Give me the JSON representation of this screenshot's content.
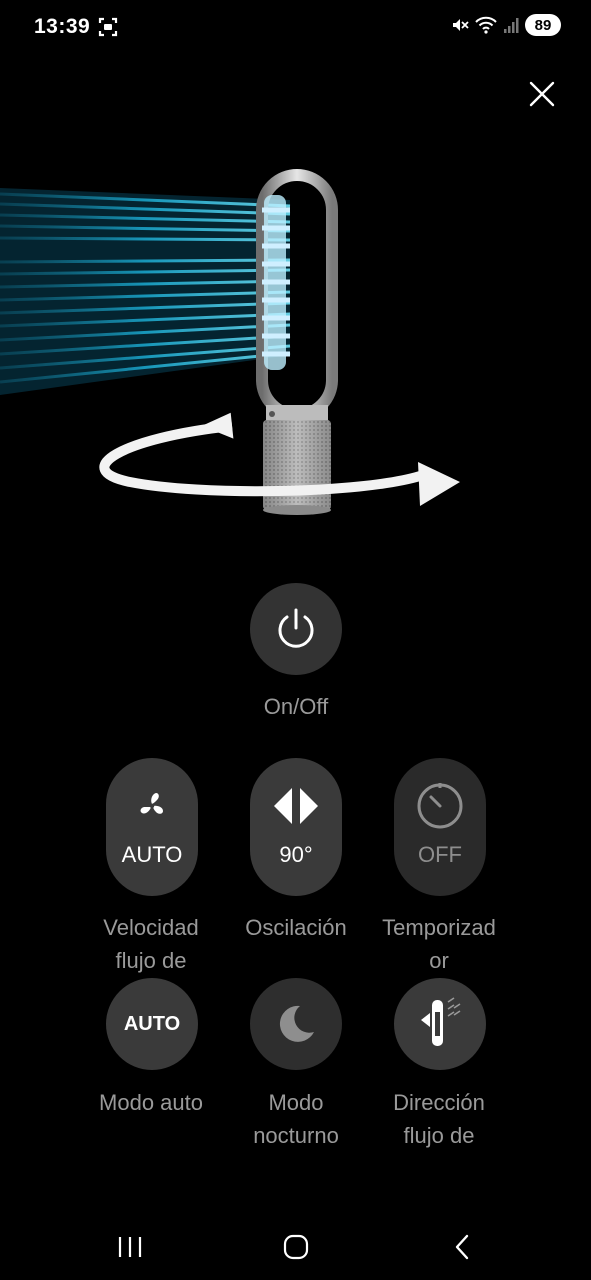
{
  "status_bar": {
    "time": "13:39",
    "battery": "89",
    "icons": [
      "screenshot-icon",
      "mute-icon",
      "wifi-icon",
      "signal-icon"
    ]
  },
  "header": {
    "close_icon": "close-icon"
  },
  "power": {
    "label": "On/Off",
    "icon": "power-icon"
  },
  "controls": [
    {
      "id": "fan-speed",
      "value": "AUTO",
      "label_line1": "Velocidad",
      "label_line2": "flujo de",
      "icon": "fan-icon"
    },
    {
      "id": "oscillation",
      "value": "90°",
      "label_line1": "Oscilación",
      "label_line2": "",
      "icon": "oscillation-icon"
    },
    {
      "id": "timer",
      "value": "OFF",
      "label_line1": "Temporizad",
      "label_line2": "or",
      "icon": "timer-icon"
    }
  ],
  "modes": [
    {
      "id": "auto-mode",
      "badge": "AUTO",
      "label_line1": "Modo auto",
      "label_line2": "",
      "icon": "auto-icon"
    },
    {
      "id": "night-mode",
      "label_line1": "Modo",
      "label_line2": "nocturno",
      "icon": "moon-icon"
    },
    {
      "id": "airflow-direction",
      "label_line1": "Dirección",
      "label_line2": "flujo de",
      "icon": "airflow-direction-icon"
    }
  ],
  "nav": {
    "icons": [
      "recents-icon",
      "home-icon",
      "back-icon"
    ]
  },
  "colors": {
    "background": "#000000",
    "button": "#333333",
    "label": "#9a9a9a",
    "airflow": "#1aa3c8"
  }
}
